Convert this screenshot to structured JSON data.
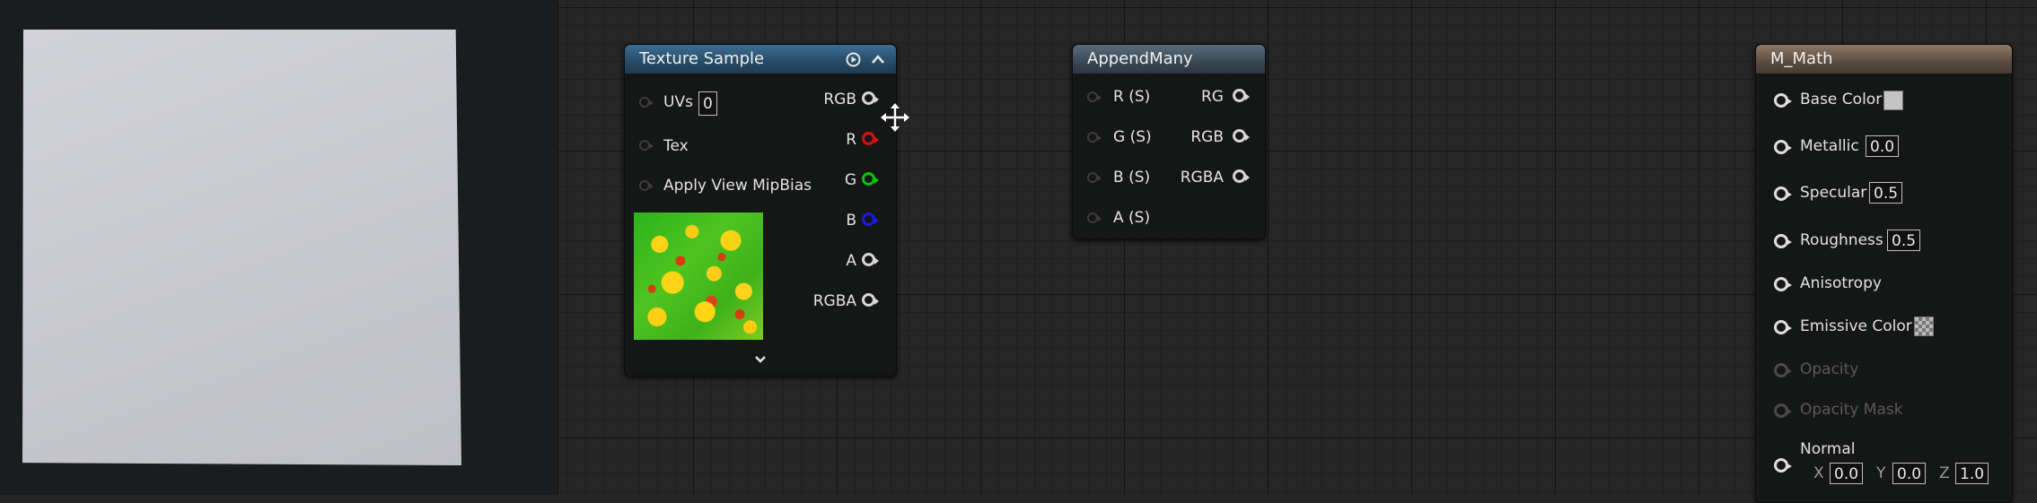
{
  "texture_sample": {
    "title": "Texture Sample",
    "inputs": [
      {
        "label": "UVs",
        "value": "0"
      },
      {
        "label": "Tex"
      },
      {
        "label": "Apply View MipBias"
      }
    ],
    "outputs": [
      {
        "label": "RGB",
        "color": "#d6d6d6"
      },
      {
        "label": "R",
        "color": "#d01212"
      },
      {
        "label": "G",
        "color": "#10c010"
      },
      {
        "label": "B",
        "color": "#1a1ae0"
      },
      {
        "label": "A",
        "color": "#d6d6d6"
      },
      {
        "label": "RGBA",
        "color": "#d6d6d6"
      }
    ],
    "header_icons": [
      "play-circle-icon",
      "chevron-up-icon"
    ],
    "footer_icon": "chevron-down-icon"
  },
  "append_many": {
    "title": "AppendMany",
    "inputs": [
      "R (S)",
      "G (S)",
      "B (S)",
      "A (S)"
    ],
    "outputs": [
      "RG",
      "RGB",
      "RGBA"
    ]
  },
  "m_math": {
    "title": "M_Math",
    "inputs": [
      {
        "label": "Base Color",
        "swatch": "#c4c4c4"
      },
      {
        "label": "Metallic",
        "value": "0.0"
      },
      {
        "label": "Specular",
        "value": "0.5"
      },
      {
        "label": "Roughness",
        "value": "0.5"
      },
      {
        "label": "Anisotropy"
      },
      {
        "label": "Emissive Color",
        "swatch": "checker"
      },
      {
        "label": "Opacity",
        "disabled": true
      },
      {
        "label": "Opacity Mask",
        "disabled": true
      },
      {
        "label": "Normal",
        "x_label": "X",
        "x": "0.0",
        "y_label": "Y",
        "y": "0.0",
        "z_label": "Z",
        "z": "1.0"
      }
    ]
  },
  "cursor_icon": "move-cursor-icon"
}
